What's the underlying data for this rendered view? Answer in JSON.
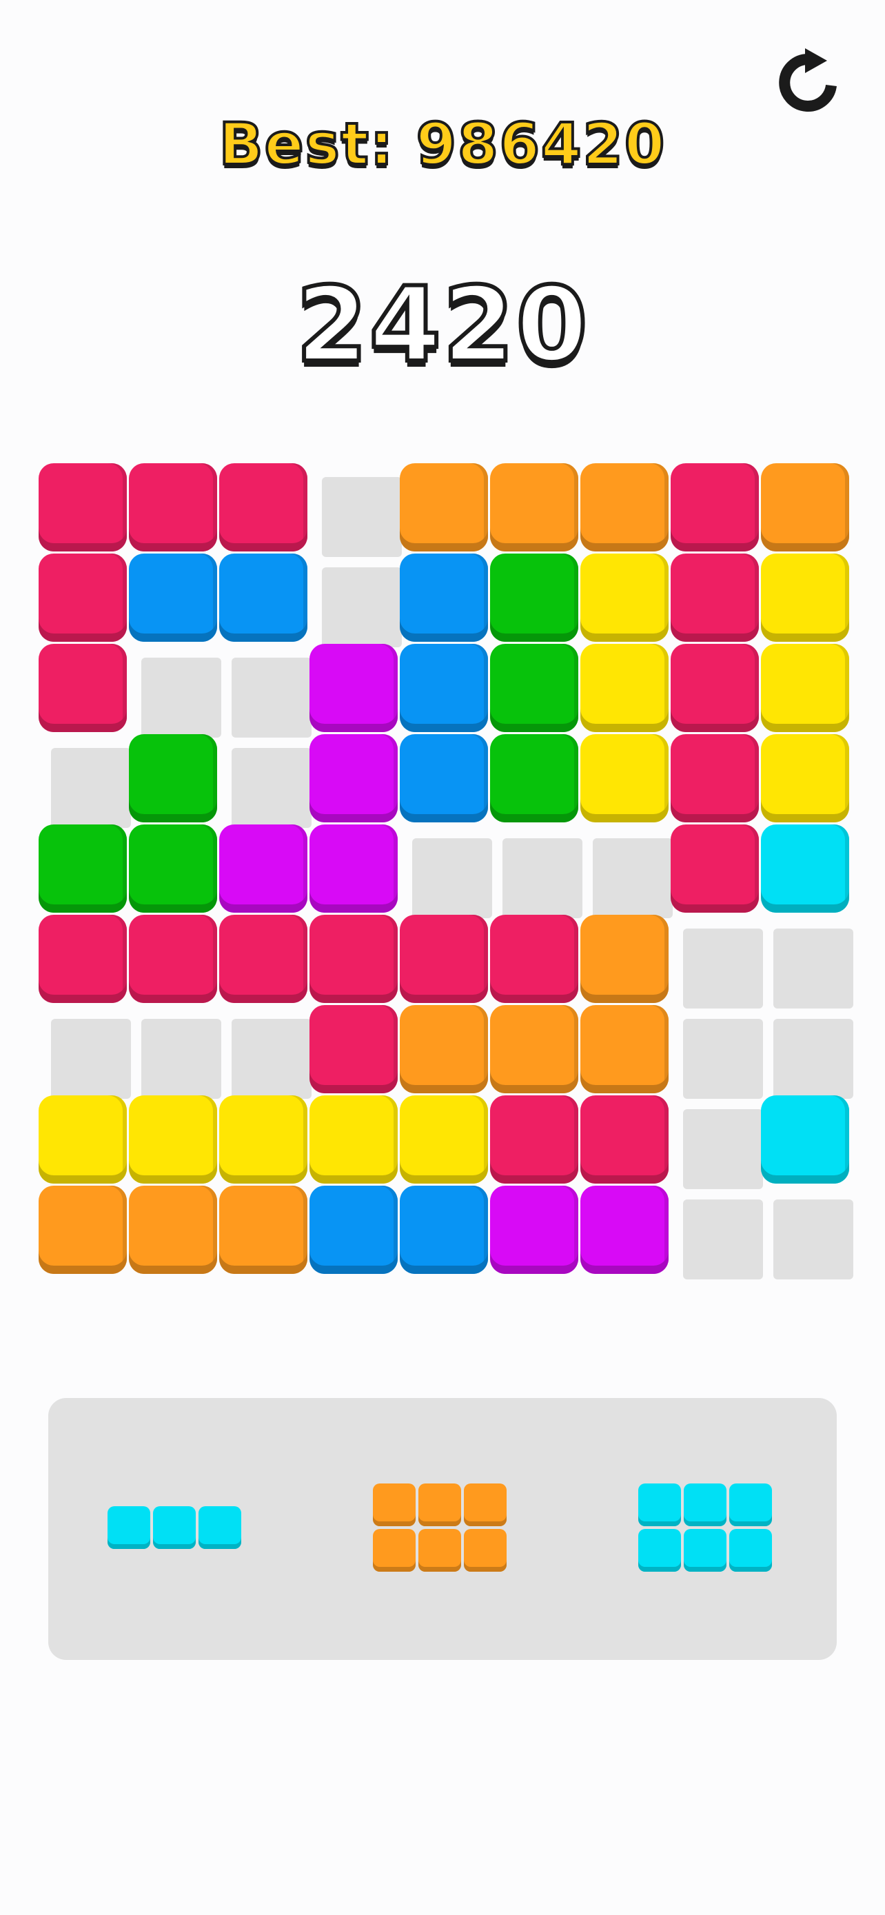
{
  "header": {
    "best_text": "Best: 986420",
    "score": "2420",
    "restart_icon": "restart-icon"
  },
  "colors": {
    "R": "#ee1f63",
    "O": "#ff9a1e",
    "B": "#0894f4",
    "G": "#07c20b",
    "Y": "#ffe603",
    "P": "#d80af6",
    "C": "#00e0f5",
    "empty": "#e0e0e0"
  },
  "board": {
    "rows": 9,
    "cols": 9,
    "grid": [
      "RRR.OOORO",
      "RBB.BGYRY",
      "R..PBGYRY",
      ".G.PBGYRY",
      "GGPP...RC",
      "RRRRRRO..",
      "...ROOO..",
      "YYYYYRR.C",
      "OOOBBPP.."
    ]
  },
  "tray": {
    "pieces": [
      {
        "color": "C",
        "shape": [
          "XXX"
        ]
      },
      {
        "color": "O",
        "shape": [
          "XXX",
          "XXX"
        ]
      },
      {
        "color": "C",
        "shape": [
          "XXX",
          "XXX"
        ]
      }
    ]
  }
}
